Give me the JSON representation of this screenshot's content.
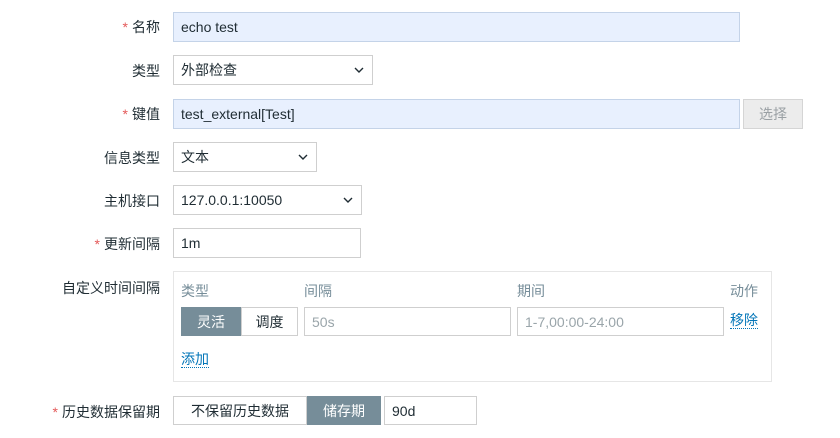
{
  "form": {
    "name": {
      "label": "名称",
      "required": true,
      "value": "echo test"
    },
    "type": {
      "label": "类型",
      "value": "外部检查"
    },
    "key": {
      "label": "键值",
      "required": true,
      "value": "test_external[Test]",
      "select_button": "选择"
    },
    "info_type": {
      "label": "信息类型",
      "value": "文本"
    },
    "host_interface": {
      "label": "主机接口",
      "value": "127.0.0.1:10050"
    },
    "update_interval": {
      "label": "更新间隔",
      "required": true,
      "value": "1m"
    },
    "custom_intervals": {
      "label": "自定义时间间隔",
      "headers": {
        "type": "类型",
        "interval": "间隔",
        "period": "期间",
        "action": "动作"
      },
      "row": {
        "flexible": "灵活",
        "scheduling": "调度",
        "interval_placeholder": "50s",
        "period_placeholder": "1-7,00:00-24:00",
        "remove": "移除"
      },
      "add": "添加"
    },
    "history": {
      "label": "历史数据保留期",
      "required": true,
      "no_keep": "不保留历史数据",
      "storage": "储存期",
      "value": "90d"
    }
  },
  "colors": {
    "required": "#e45959",
    "accent": "#768d99",
    "link": "#0275b8",
    "filled_bg": "#e8f0fe"
  },
  "icons": {
    "select_arrow": "chevron-down-icon"
  }
}
